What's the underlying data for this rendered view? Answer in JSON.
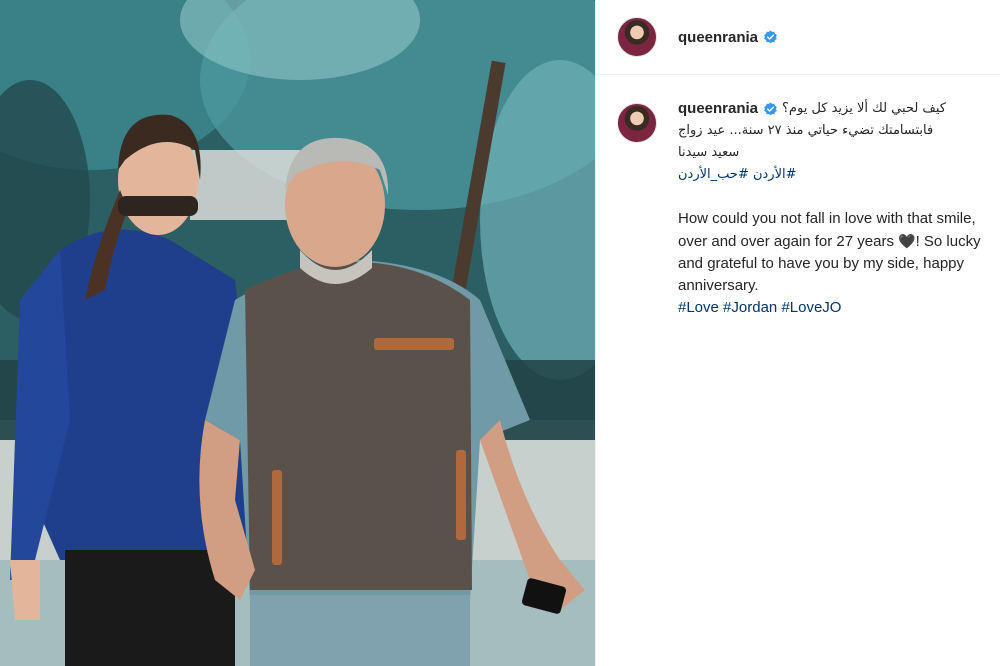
{
  "header": {
    "username": "queenrania",
    "verified": true,
    "verified_icon": "verified-badge-icon",
    "accent_color": "#0095f6"
  },
  "post": {
    "username": "queenrania",
    "caption_arabic_line1": "كيف لحبي لك ألا يزيد كل يوم؟",
    "caption_arabic_line2": "فابتسامتك تضيء حياتي منذ ٢٧ سنة... عيد زواج",
    "caption_arabic_line3": "سعيد سيدنا",
    "hashtags_arabic": "#الأردن #حب_الأردن",
    "caption_english_part1": "How could you not fall in love with that smile, over and over again for 27 years ",
    "heart": "🖤",
    "caption_english_part2": "! So lucky and grateful to have you by my side, happy anniversary.",
    "hashtags_english": [
      "#Love",
      "#Jordan",
      "#LoveJO"
    ],
    "hashtag_color": "#00376b"
  },
  "photo": {
    "subject": "couple walking outdoors holding hands"
  }
}
